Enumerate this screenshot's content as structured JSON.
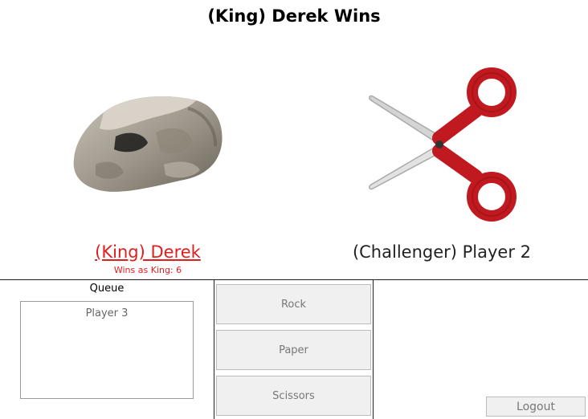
{
  "header": {
    "title": "(King) Derek Wins"
  },
  "king": {
    "name": "(King) Derek",
    "wins_label": "Wins as King: 6",
    "move_icon": "rock-icon",
    "color": "#e11d1d"
  },
  "challenger": {
    "name": "(Challenger) Player 2",
    "move_icon": "scissors-icon"
  },
  "queue": {
    "label": "Queue",
    "items": [
      "Player 3"
    ]
  },
  "moves": {
    "rock": "Rock",
    "paper": "Paper",
    "scissors": "Scissors"
  },
  "logout_label": "Logout"
}
